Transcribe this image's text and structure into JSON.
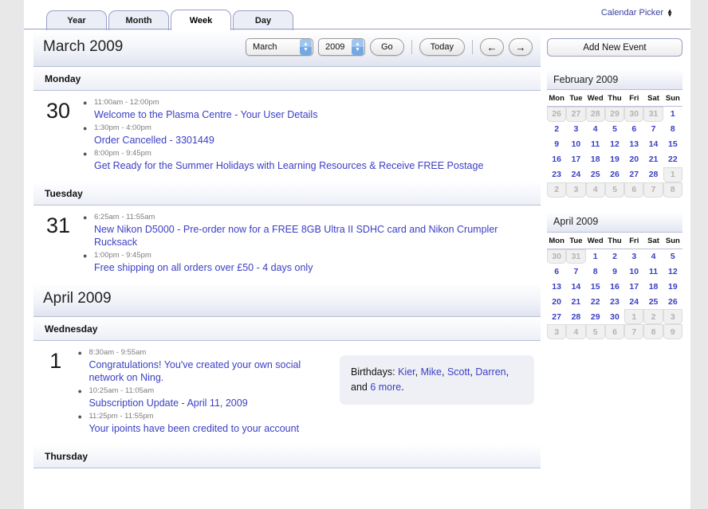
{
  "tabs": [
    {
      "label": "Year",
      "active": false
    },
    {
      "label": "Month",
      "active": false
    },
    {
      "label": "Week",
      "active": true
    },
    {
      "label": "Day",
      "active": false
    }
  ],
  "calendar_picker": {
    "label": "Calendar Picker",
    "icon": "updown-arrows-icon"
  },
  "header": {
    "title": "March 2009",
    "month_select": "March",
    "year_select": "2009",
    "go_button": "Go",
    "today_button": "Today",
    "prev_arrow": "←",
    "next_arrow": "→"
  },
  "sidebar": {
    "add_event_button": "Add New Event",
    "calendars": [
      {
        "title": "February 2009",
        "weekdays": [
          "Mon",
          "Tue",
          "Wed",
          "Thu",
          "Fri",
          "Sat",
          "Sun"
        ],
        "weeks": [
          [
            {
              "d": "26",
              "out": true
            },
            {
              "d": "27",
              "out": true
            },
            {
              "d": "28",
              "out": true
            },
            {
              "d": "29",
              "out": true
            },
            {
              "d": "30",
              "out": true
            },
            {
              "d": "31",
              "out": true
            },
            {
              "d": "1",
              "out": false
            }
          ],
          [
            {
              "d": "2",
              "out": false
            },
            {
              "d": "3",
              "out": false
            },
            {
              "d": "4",
              "out": false
            },
            {
              "d": "5",
              "out": false
            },
            {
              "d": "6",
              "out": false
            },
            {
              "d": "7",
              "out": false
            },
            {
              "d": "8",
              "out": false
            }
          ],
          [
            {
              "d": "9",
              "out": false
            },
            {
              "d": "10",
              "out": false
            },
            {
              "d": "11",
              "out": false
            },
            {
              "d": "12",
              "out": false
            },
            {
              "d": "13",
              "out": false
            },
            {
              "d": "14",
              "out": false
            },
            {
              "d": "15",
              "out": false
            }
          ],
          [
            {
              "d": "16",
              "out": false
            },
            {
              "d": "17",
              "out": false
            },
            {
              "d": "18",
              "out": false
            },
            {
              "d": "19",
              "out": false
            },
            {
              "d": "20",
              "out": false
            },
            {
              "d": "21",
              "out": false
            },
            {
              "d": "22",
              "out": false
            }
          ],
          [
            {
              "d": "23",
              "out": false
            },
            {
              "d": "24",
              "out": false
            },
            {
              "d": "25",
              "out": false
            },
            {
              "d": "26",
              "out": false
            },
            {
              "d": "27",
              "out": false
            },
            {
              "d": "28",
              "out": false
            },
            {
              "d": "1",
              "out": true
            }
          ],
          [
            {
              "d": "2",
              "out": true
            },
            {
              "d": "3",
              "out": true
            },
            {
              "d": "4",
              "out": true
            },
            {
              "d": "5",
              "out": true
            },
            {
              "d": "6",
              "out": true
            },
            {
              "d": "7",
              "out": true
            },
            {
              "d": "8",
              "out": true
            }
          ]
        ]
      },
      {
        "title": "April 2009",
        "weekdays": [
          "Mon",
          "Tue",
          "Wed",
          "Thu",
          "Fri",
          "Sat",
          "Sun"
        ],
        "weeks": [
          [
            {
              "d": "30",
              "out": true
            },
            {
              "d": "31",
              "out": true
            },
            {
              "d": "1",
              "out": false
            },
            {
              "d": "2",
              "out": false
            },
            {
              "d": "3",
              "out": false
            },
            {
              "d": "4",
              "out": false
            },
            {
              "d": "5",
              "out": false
            }
          ],
          [
            {
              "d": "6",
              "out": false
            },
            {
              "d": "7",
              "out": false
            },
            {
              "d": "8",
              "out": false
            },
            {
              "d": "9",
              "out": false
            },
            {
              "d": "10",
              "out": false
            },
            {
              "d": "11",
              "out": false
            },
            {
              "d": "12",
              "out": false
            }
          ],
          [
            {
              "d": "13",
              "out": false
            },
            {
              "d": "14",
              "out": false
            },
            {
              "d": "15",
              "out": false
            },
            {
              "d": "16",
              "out": false
            },
            {
              "d": "17",
              "out": false
            },
            {
              "d": "18",
              "out": false
            },
            {
              "d": "19",
              "out": false
            }
          ],
          [
            {
              "d": "20",
              "out": false
            },
            {
              "d": "21",
              "out": false
            },
            {
              "d": "22",
              "out": false
            },
            {
              "d": "23",
              "out": false
            },
            {
              "d": "24",
              "out": false
            },
            {
              "d": "25",
              "out": false
            },
            {
              "d": "26",
              "out": false
            }
          ],
          [
            {
              "d": "27",
              "out": false
            },
            {
              "d": "28",
              "out": false
            },
            {
              "d": "29",
              "out": false
            },
            {
              "d": "30",
              "out": false
            },
            {
              "d": "1",
              "out": true
            },
            {
              "d": "2",
              "out": true
            },
            {
              "d": "3",
              "out": true
            }
          ],
          [
            {
              "d": "3",
              "out": true
            },
            {
              "d": "4",
              "out": true
            },
            {
              "d": "5",
              "out": true
            },
            {
              "d": "6",
              "out": true
            },
            {
              "d": "7",
              "out": true
            },
            {
              "d": "8",
              "out": true
            },
            {
              "d": "9",
              "out": true
            }
          ]
        ]
      }
    ]
  },
  "months": [
    {
      "banner": "March 2009",
      "has_banner": false,
      "days": [
        {
          "weekday": "Monday",
          "daynum": "30",
          "events": [
            {
              "time": "11:00am - 12:00pm",
              "title": "Welcome to the Plasma Centre - Your User Details"
            },
            {
              "time": "1:30pm - 4:00pm",
              "title": "Order Cancelled - 3301449"
            },
            {
              "time": "8:00pm - 9:45pm",
              "title": "Get Ready for the Summer Holidays with Learning Resources & Receive FREE Postage"
            }
          ],
          "birthdays": null
        },
        {
          "weekday": "Tuesday",
          "daynum": "31",
          "events": [
            {
              "time": "6:25am - 11:55am",
              "title": "New Nikon D5000 - Pre-order now for a FREE 8GB Ultra II SDHC card and Nikon Crumpler Rucksack"
            },
            {
              "time": "1:00pm - 9:45pm",
              "title": "Free shipping on all orders over £50 - 4 days only"
            }
          ],
          "birthdays": null
        }
      ]
    },
    {
      "banner": "April 2009",
      "has_banner": true,
      "days": [
        {
          "weekday": "Wednesday",
          "daynum": "1",
          "events": [
            {
              "time": "8:30am - 9:55am",
              "title": "Congratulations! You've created your own social network on Ning."
            },
            {
              "time": "10:25am - 11:05am",
              "title": "Subscription Update - April 11, 2009"
            },
            {
              "time": "11:25pm - 11:55pm",
              "title": "Your ipoints have been credited to your account"
            }
          ],
          "birthdays": {
            "label": "Birthdays:",
            "names": [
              "Kier",
              "Mike",
              "Scott",
              "Darren"
            ],
            "and": "and",
            "more": "6 more",
            "period": "."
          }
        },
        {
          "weekday": "Thursday",
          "daynum": "",
          "events": [],
          "birthdays": null
        }
      ]
    }
  ],
  "colors": {
    "link": "#3b3fc4",
    "border": "#b9bed8",
    "page_bg": "#e8e8e8"
  }
}
